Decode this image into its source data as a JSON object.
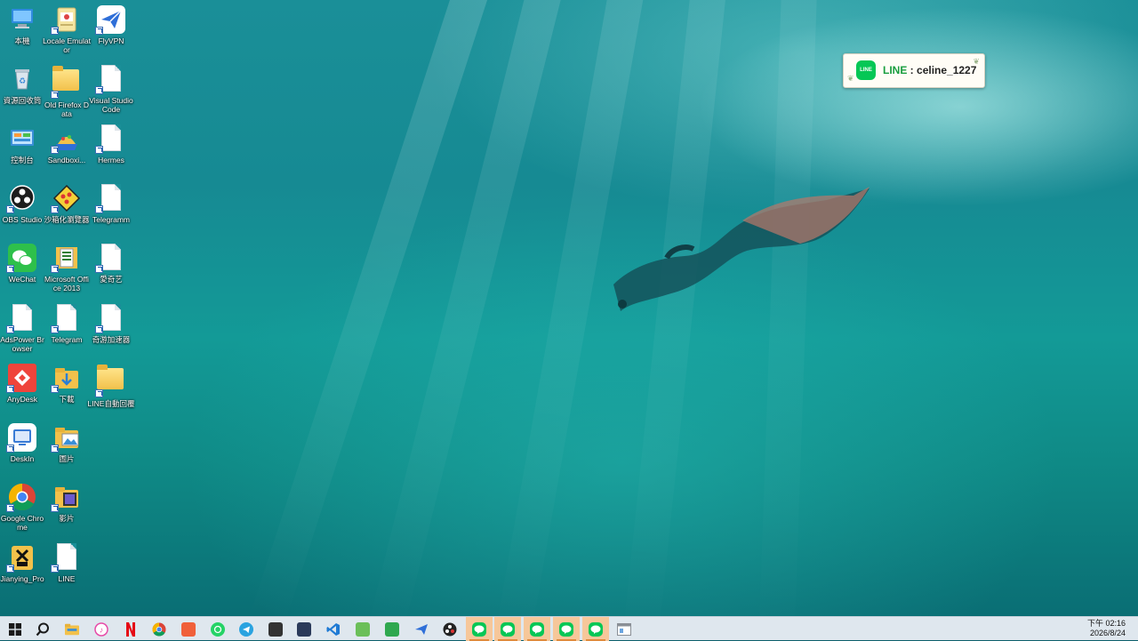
{
  "desktop": {
    "icons": [
      {
        "id": "this-pc",
        "label": "本機",
        "icon": "computer-icon",
        "col": 0,
        "row": 0
      },
      {
        "id": "locale-emulator",
        "label": "Locale Emulator",
        "icon": "locale-emulator-icon",
        "col": 1,
        "row": 0
      },
      {
        "id": "flyvpn",
        "label": "FlyVPN",
        "icon": "flyvpn-icon",
        "col": 2,
        "row": 0
      },
      {
        "id": "recycle-bin",
        "label": "資源回收筒",
        "icon": "recycle-bin-icon",
        "col": 0,
        "row": 1
      },
      {
        "id": "old-firefox-data",
        "label": "Old Firefox Data",
        "icon": "folder-icon",
        "col": 1,
        "row": 1
      },
      {
        "id": "visual-studio-code",
        "label": "Visual Studio Code",
        "icon": "document-icon",
        "col": 2,
        "row": 1
      },
      {
        "id": "control-panel",
        "label": "控制台",
        "icon": "control-panel-icon",
        "col": 0,
        "row": 2
      },
      {
        "id": "sandboxie",
        "label": "Sandboxi...",
        "icon": "sandboxie-icon",
        "col": 1,
        "row": 2
      },
      {
        "id": "hermes",
        "label": "Hermes",
        "icon": "document-icon",
        "col": 2,
        "row": 2
      },
      {
        "id": "obs-studio",
        "label": "OBS Studio",
        "icon": "obs-icon",
        "col": 0,
        "row": 3
      },
      {
        "id": "sandbox-browser",
        "label": "沙箱化瀏覽器",
        "icon": "sandbox-browser-icon",
        "col": 1,
        "row": 3
      },
      {
        "id": "telegramm",
        "label": "Telegramm",
        "icon": "document-icon",
        "col": 2,
        "row": 3
      },
      {
        "id": "wechat",
        "label": "WeChat",
        "icon": "wechat-icon",
        "col": 0,
        "row": 4
      },
      {
        "id": "microsoft-office-2013",
        "label": "Microsoft Office 2013",
        "icon": "office-folder-icon",
        "col": 1,
        "row": 4
      },
      {
        "id": "iqiyi",
        "label": "愛奇艺",
        "icon": "document-icon",
        "col": 2,
        "row": 4
      },
      {
        "id": "adspower-browser",
        "label": "AdsPower Browser",
        "icon": "document-icon",
        "col": 0,
        "row": 5
      },
      {
        "id": "telegram",
        "label": "Telegram",
        "icon": "document-icon",
        "col": 1,
        "row": 5
      },
      {
        "id": "accelerator",
        "label": "奇游加速器",
        "icon": "document-icon",
        "col": 2,
        "row": 5
      },
      {
        "id": "anydesk",
        "label": "AnyDesk",
        "icon": "anydesk-icon",
        "col": 0,
        "row": 6
      },
      {
        "id": "downloads",
        "label": "下載",
        "icon": "download-folder-icon",
        "col": 1,
        "row": 6
      },
      {
        "id": "line-auto-reply",
        "label": "LINE自動回覆",
        "icon": "folder-icon",
        "col": 2,
        "row": 6
      },
      {
        "id": "deskin",
        "label": "DeskIn",
        "icon": "deskin-icon",
        "col": 0,
        "row": 7
      },
      {
        "id": "pictures",
        "label": "圖片",
        "icon": "pictures-folder-icon",
        "col": 1,
        "row": 7
      },
      {
        "id": "google-chrome",
        "label": "Google Chrome",
        "icon": "chrome-icon",
        "col": 0,
        "row": 8
      },
      {
        "id": "videos",
        "label": "影片",
        "icon": "videos-folder-icon",
        "col": 1,
        "row": 8
      },
      {
        "id": "jianying-pro",
        "label": "Jianying_Pro",
        "icon": "jianying-icon",
        "col": 0,
        "row": 9
      },
      {
        "id": "line",
        "label": "LINE",
        "icon": "document-icon",
        "col": 1,
        "row": 9
      }
    ]
  },
  "notification": {
    "logo_text": "LINE",
    "app": "LINE",
    "separator": " : ",
    "account": "celine_1227"
  },
  "taskbar": {
    "items": [
      {
        "id": "start",
        "icon": "windows-start-icon",
        "color": "#1a1a1a",
        "running": false
      },
      {
        "id": "search",
        "icon": "search-icon",
        "color": "#1a1a1a",
        "running": false
      },
      {
        "id": "file-explorer",
        "icon": "file-explorer-icon",
        "color": "#f2c14b",
        "running": false
      },
      {
        "id": "itunes",
        "icon": "itunes-icon",
        "color": "#e74aa8",
        "running": false
      },
      {
        "id": "netflix",
        "icon": "netflix-icon",
        "color": "#e50914",
        "running": false
      },
      {
        "id": "chrome",
        "icon": "chrome-icon",
        "color": "#db4437",
        "running": false
      },
      {
        "id": "app-red",
        "icon": "sparkle-app-icon",
        "color": "#f0603a",
        "running": false
      },
      {
        "id": "whatsapp",
        "icon": "whatsapp-icon",
        "color": "#25d366",
        "running": false
      },
      {
        "id": "telegram",
        "icon": "telegram-icon",
        "color": "#2aa3e0",
        "running": false
      },
      {
        "id": "sticky-app",
        "icon": "sticky-note-icon",
        "color": "#333333",
        "running": false
      },
      {
        "id": "powershell",
        "icon": "terminal-icon",
        "color": "#2b3a5a",
        "running": false
      },
      {
        "id": "vscode",
        "icon": "vscode-icon",
        "color": "#1f7ad4",
        "running": false
      },
      {
        "id": "gem-app",
        "icon": "gem-app-icon",
        "color": "#6bbf59",
        "running": false
      },
      {
        "id": "green-app",
        "icon": "green-app-icon",
        "color": "#2fa84f",
        "running": false
      },
      {
        "id": "flyvpn",
        "icon": "flyvpn-icon",
        "color": "#2f6fd8",
        "running": false
      },
      {
        "id": "obs",
        "icon": "obs-icon",
        "color": "#222222",
        "running": false
      },
      {
        "id": "line-1",
        "icon": "line-icon",
        "color": "#06c755",
        "running": true
      },
      {
        "id": "line-2",
        "icon": "line-icon",
        "color": "#06c755",
        "running": true
      },
      {
        "id": "line-3",
        "icon": "line-icon",
        "color": "#06c755",
        "running": true
      },
      {
        "id": "line-4",
        "icon": "line-icon",
        "color": "#06c755",
        "running": true
      },
      {
        "id": "line-5",
        "icon": "line-icon",
        "color": "#06c755",
        "running": true
      },
      {
        "id": "window-app",
        "icon": "window-icon",
        "color": "#8a8f96",
        "running": false
      }
    ],
    "clock": {
      "time": "下午 02:16",
      "date": "2026/8/24"
    }
  }
}
